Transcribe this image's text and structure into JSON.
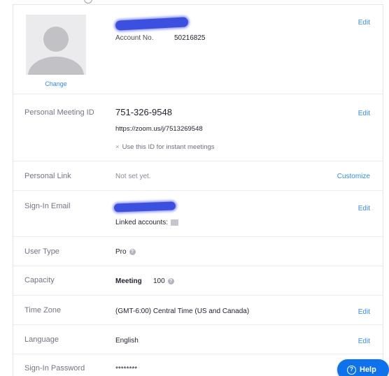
{
  "profile": {
    "change_label": "Change",
    "account_no_label": "Account No.",
    "account_no": "50216825",
    "edit_label": "Edit"
  },
  "pmi": {
    "label": "Personal Meeting ID",
    "id": "751-326-9548",
    "url": "https://zoom.us/j/7513269548",
    "instant_option": "Use this ID for instant meetings",
    "edit_label": "Edit"
  },
  "personal_link": {
    "label": "Personal Link",
    "value": "Not set yet.",
    "action_label": "Customize"
  },
  "sign_in_email": {
    "label": "Sign-In Email",
    "linked_accounts_label": "Linked accounts:",
    "edit_label": "Edit"
  },
  "user_type": {
    "label": "User Type",
    "value": "Pro"
  },
  "capacity": {
    "label": "Capacity",
    "meeting_label": "Meeting",
    "meeting_value": "100"
  },
  "time_zone": {
    "label": "Time Zone",
    "value": "(GMT-6:00) Central Time (US and Canada)",
    "edit_label": "Edit"
  },
  "language": {
    "label": "Language",
    "value": "English",
    "edit_label": "Edit"
  },
  "password": {
    "label": "Sign-In Password",
    "value": "********"
  },
  "help": {
    "label": "Help"
  },
  "colors": {
    "link": "#2d8cff",
    "help_button": "#0e72ed",
    "redaction": "#3b4fe0"
  }
}
